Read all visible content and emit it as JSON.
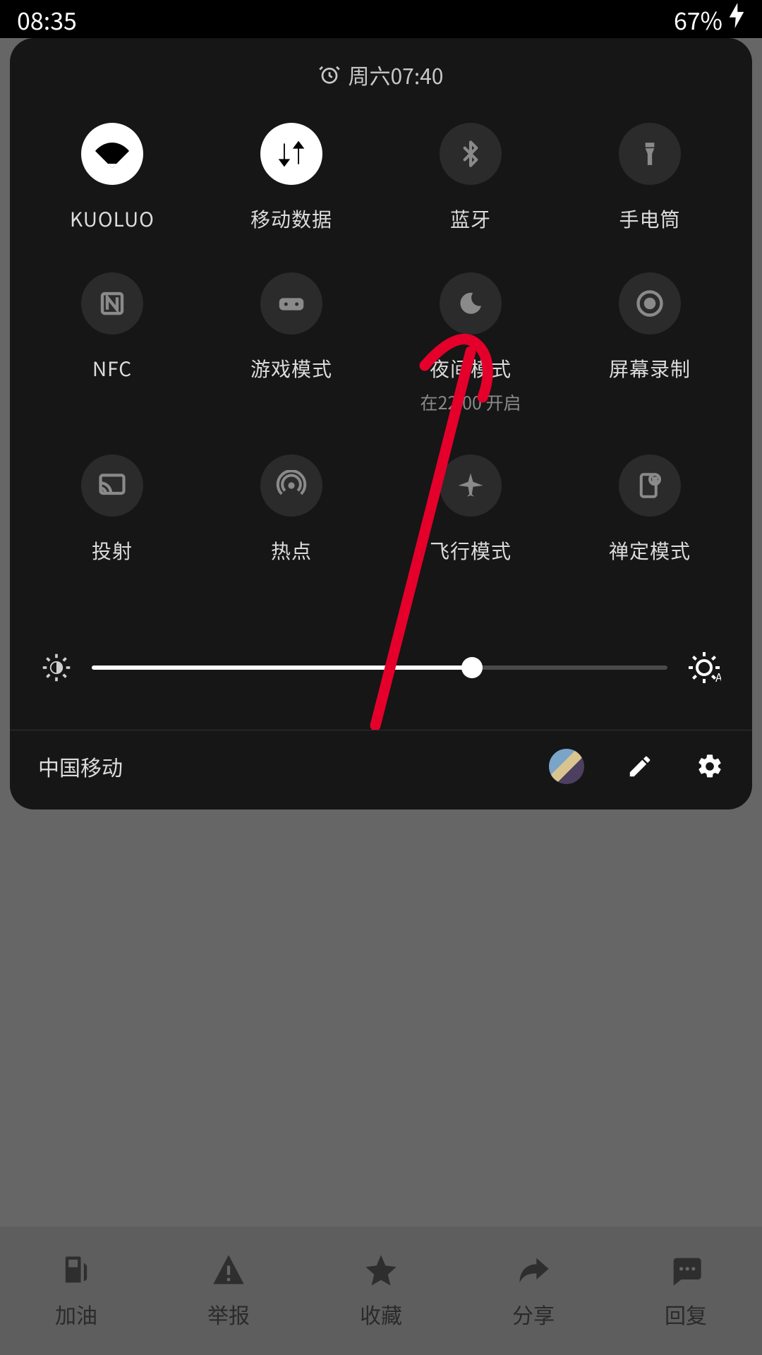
{
  "statusbar": {
    "time": "08:35",
    "battery": "67%"
  },
  "panel": {
    "alarm": "周六07:40",
    "tiles": [
      {
        "id": "wifi",
        "label": "KUOLUO",
        "sublabel": "",
        "active": true
      },
      {
        "id": "data",
        "label": "移动数据",
        "sublabel": "",
        "active": true
      },
      {
        "id": "bluetooth",
        "label": "蓝牙",
        "sublabel": "",
        "active": false
      },
      {
        "id": "flashlight",
        "label": "手电筒",
        "sublabel": "",
        "active": false
      },
      {
        "id": "nfc",
        "label": "NFC",
        "sublabel": "",
        "active": false
      },
      {
        "id": "game",
        "label": "游戏模式",
        "sublabel": "",
        "active": false
      },
      {
        "id": "night",
        "label": "夜间模式",
        "sublabel": "在22:00 开启",
        "active": false
      },
      {
        "id": "record",
        "label": "屏幕录制",
        "sublabel": "",
        "active": false
      },
      {
        "id": "cast",
        "label": "投射",
        "sublabel": "",
        "active": false
      },
      {
        "id": "hotspot",
        "label": "热点",
        "sublabel": "",
        "active": false
      },
      {
        "id": "airplane",
        "label": "飞行模式",
        "sublabel": "",
        "active": false
      },
      {
        "id": "zen",
        "label": "禅定模式",
        "sublabel": "",
        "active": false
      }
    ],
    "brightness_pct": 66,
    "carrier": "中国移动"
  },
  "bottom_nav": [
    {
      "id": "fuel",
      "label": "加油"
    },
    {
      "id": "report",
      "label": "举报"
    },
    {
      "id": "fav",
      "label": "收藏"
    },
    {
      "id": "share",
      "label": "分享"
    },
    {
      "id": "reply",
      "label": "回复"
    }
  ],
  "colors": {
    "panel_bg": "#161616",
    "tile_off": "#2b2b2b",
    "tile_on": "#ffffff",
    "accent_annotation": "#e4002b"
  }
}
